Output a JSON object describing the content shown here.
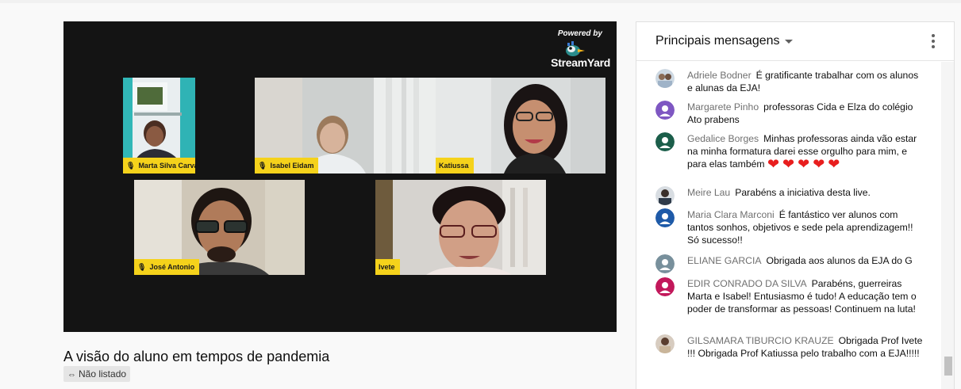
{
  "player": {
    "brand": {
      "powered": "Powered by",
      "name": "StreamYard"
    },
    "participants": [
      {
        "name": "Marta Silva Carvalho"
      },
      {
        "name": "Isabel Eidam"
      },
      {
        "name": "Katiussa"
      },
      {
        "name": "José Antonio"
      },
      {
        "name": "Ivete"
      }
    ]
  },
  "video": {
    "title": "A visão do aluno em tempos de pandemia",
    "visibility": "Não listado"
  },
  "chat": {
    "header": "Principais mensagens",
    "messages": [
      {
        "author": "Adriele Bodner",
        "text": "É gratificante trabalhar com os alunos e alunas da EJA!"
      },
      {
        "author": "Margarete Pinho",
        "text": "professoras Cida e Elza do colégio Ato prabens"
      },
      {
        "author": "Gedalice Borges",
        "text": "Minhas professoras ainda vão estar na minha formatura darei esse orgulho para mim, e para elas também",
        "emoji": "❤❤❤❤❤"
      },
      {
        "author": "Meire Lau",
        "text": "Parabéns a iniciativa desta live."
      },
      {
        "author": "Maria Clara Marconi",
        "text": "É fantástico ver alunos com tantos sonhos, objetivos e sede pela aprendizagem!! Só sucesso!!"
      },
      {
        "author": "ELIANE GARCIA",
        "text": "Obrigada aos alunos da EJA do G"
      },
      {
        "author": "EDIR CONRADO DA SILVA",
        "text": "Parabéns, guerreiras Marta e Isabel! Entusiasmo é tudo! A educação tem o poder de transformar as pessoas! Continuem na luta!"
      },
      {
        "author": "GILSAMARA TIBURCIO KRAUZE",
        "text": "Obrigada Prof Ivete !!! Obrigada Prof Katiussa pelo trabalho com a EJA!!!!!"
      }
    ]
  },
  "colors": {
    "nametag": "#f5d21b",
    "player_bg": "#141414",
    "avatar_purple": "#7e57c2",
    "avatar_green": "#1b5e4a",
    "avatar_blue": "#1e5aa8",
    "avatar_gray": "#78909c",
    "avatar_pink": "#c2185b"
  }
}
